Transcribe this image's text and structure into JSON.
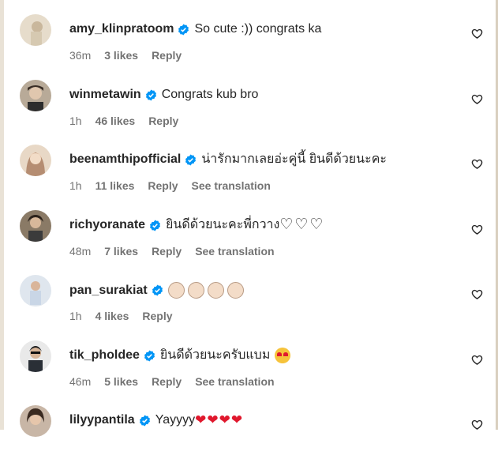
{
  "comments": [
    {
      "username": "amy_klinpratoom",
      "text": "So cute :)) congrats ka",
      "time": "36m",
      "likes": "3 likes",
      "reply": "Reply",
      "translation": "",
      "avatar_color": "#d7cbb3"
    },
    {
      "username": "winmetawin",
      "text": "Congrats kub bro",
      "time": "1h",
      "likes": "46 likes",
      "reply": "Reply",
      "translation": "",
      "avatar_color": "#9a8a7a"
    },
    {
      "username": "beenamthipofficial",
      "text": "น่ารักมากเลยอ่ะคู่นี้ ยินดีด้วยนะคะ",
      "time": "1h",
      "likes": "11 likes",
      "reply": "Reply",
      "translation": "See translation",
      "avatar_color": "#c9a98e"
    },
    {
      "username": "richyoranate",
      "text": "ยินดีด้วยนะคะพี่กวาง",
      "time": "48m",
      "likes": "7 likes",
      "reply": "Reply",
      "translation": "See translation",
      "avatar_color": "#6f5d4d"
    },
    {
      "username": "pan_surakiat",
      "text": "",
      "time": "1h",
      "likes": "4 likes",
      "reply": "Reply",
      "translation": "",
      "avatar_color": "#aab6c3"
    },
    {
      "username": "tik_pholdee",
      "text": "ยินดีด้วยนะครับแบม",
      "time": "46m",
      "likes": "5 likes",
      "reply": "Reply",
      "translation": "See translation",
      "avatar_color": "#3c4a58"
    },
    {
      "username": "lilyypantila",
      "text": "Yayyyy",
      "time": "",
      "likes": "",
      "reply": "",
      "translation": "",
      "avatar_color": "#8d7868"
    }
  ],
  "icons": {
    "verified": "verified-badge-icon",
    "like": "heart-outline-icon"
  },
  "colors": {
    "verified": "#0095f6",
    "muted": "#737373",
    "text": "#262626",
    "heart": "#e0182d"
  }
}
